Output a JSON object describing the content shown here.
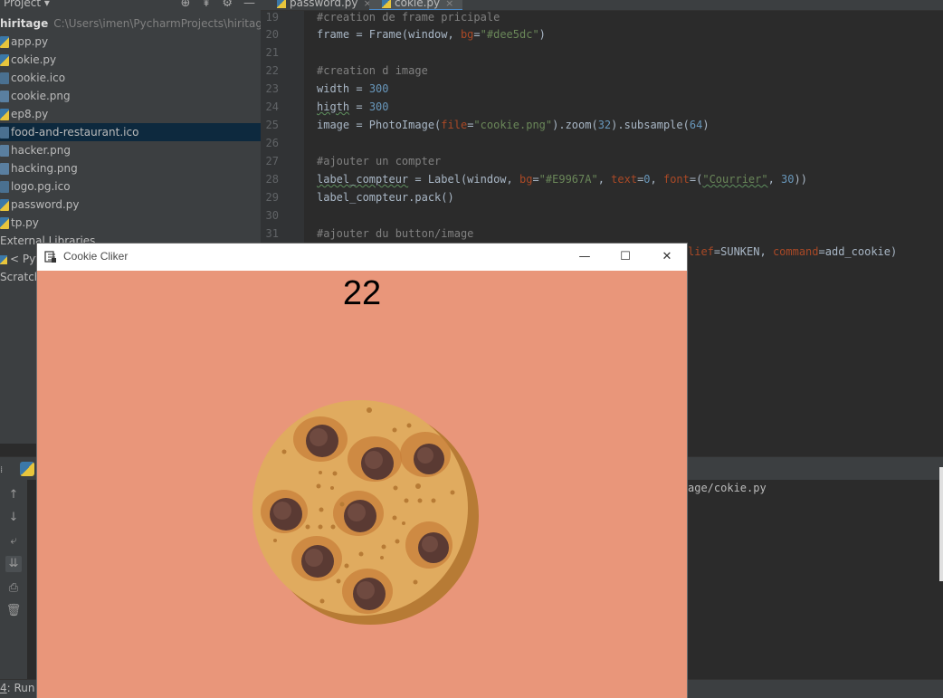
{
  "project": {
    "header_title": "Project ▾",
    "root_name": "hiritage",
    "root_path": "C:\\Users\\imen\\PycharmProjects\\hiritage",
    "files": [
      {
        "name": "app.py",
        "icon": "python-file-icon",
        "type": "py"
      },
      {
        "name": "cokie.py",
        "icon": "python-file-icon",
        "type": "py"
      },
      {
        "name": "cookie.ico",
        "icon": "ico-file-icon",
        "type": "ico"
      },
      {
        "name": "cookie.png",
        "icon": "image-file-icon",
        "type": "img"
      },
      {
        "name": "ep8.py",
        "icon": "python-file-icon",
        "type": "py"
      },
      {
        "name": "food-and-restaurant.ico",
        "icon": "ico-file-icon",
        "type": "ico",
        "selected": true
      },
      {
        "name": "hacker.png",
        "icon": "image-file-icon",
        "type": "img"
      },
      {
        "name": "hacking.png",
        "icon": "image-file-icon",
        "type": "img"
      },
      {
        "name": "logo.pg.ico",
        "icon": "ico-file-icon",
        "type": "ico"
      },
      {
        "name": "password.py",
        "icon": "python-file-icon",
        "type": "py"
      },
      {
        "name": "tp.py",
        "icon": "python-file-icon",
        "type": "py"
      }
    ],
    "external_libraries": "External Libraries",
    "python_sdk": "< Pyt",
    "scratches": "Scratches"
  },
  "tabs": [
    {
      "label": "password.py",
      "active": false
    },
    {
      "label": "cokie.py",
      "active": true
    }
  ],
  "code": {
    "line_numbers": [
      "19",
      "20",
      "21",
      "22",
      "23",
      "24",
      "25",
      "26",
      "27",
      "28",
      "29",
      "30",
      "31"
    ],
    "lines": {
      "l19": "#creation de frame pricipale",
      "l20_a": "frame = Frame(window, ",
      "l20_b": "bg",
      "l20_c": "=",
      "l20_d": "\"#dee5dc\"",
      "l20_e": ")",
      "l22": "#creation d image",
      "l23_a": "width",
      "l23_b": " = ",
      "l23_c": "300",
      "l24_a": "higth",
      "l24_b": " = ",
      "l24_c": "300",
      "l25_a": "image = PhotoImage(",
      "l25_b": "file",
      "l25_c": "=",
      "l25_d": "\"cookie.png\"",
      "l25_e": ").zoom(",
      "l25_f": "32",
      "l25_g": ").subsample(",
      "l25_h": "64",
      "l25_i": ")",
      "l27": "#ajouter un compter",
      "l28_a": "label_compteur",
      "l28_b": " = Label(window, ",
      "l28_c": "bg",
      "l28_d": "=",
      "l28_e": "\"#E9967A\"",
      "l28_f": ", ",
      "l28_g": "text",
      "l28_h": "=",
      "l28_i": "0",
      "l28_j": ", ",
      "l28_k": "font",
      "l28_l": "=(",
      "l28_m": "\"Courrier\"",
      "l28_n": ", ",
      "l28_o": "30",
      "l28_p": "))",
      "l29": "label_compteur.pack()",
      "l31": "#ajouter du button/image",
      "l32_a": "lief",
      "l32_b": "=SUNKEN, ",
      "l32_c": "command",
      "l32_d": "=add_cookie)"
    }
  },
  "run": {
    "console_text": "age/cokie.py",
    "run_tab_number": "4",
    "run_tab_label": ": Run"
  },
  "tk_window": {
    "title": "Cookie Cliker",
    "counter": "22",
    "minimize": "—",
    "maximize": "☐",
    "close": "✕"
  },
  "colors": {
    "tk_background": "#E9967A",
    "ide_background": "#2b2b2b",
    "panel_background": "#3c3f41",
    "selection": "#0d293e"
  }
}
